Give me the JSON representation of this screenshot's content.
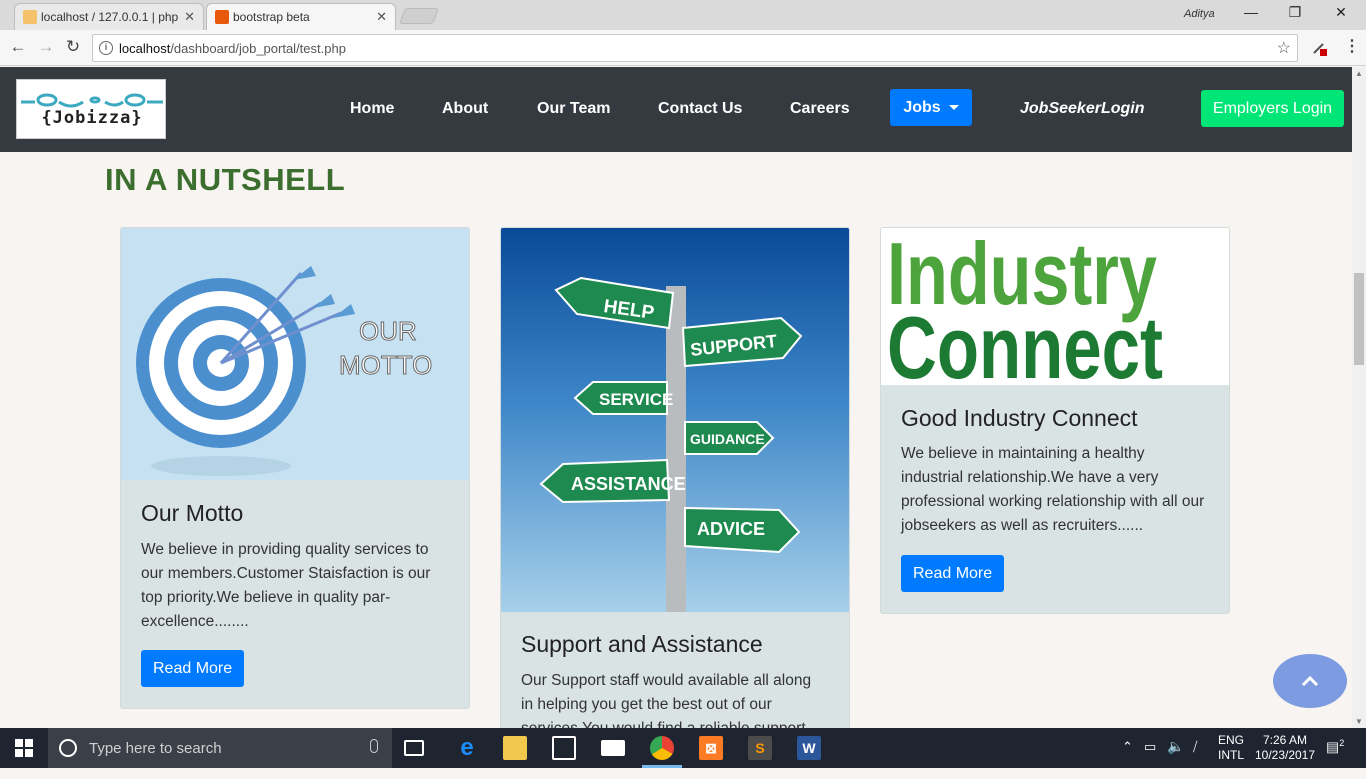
{
  "browser": {
    "tabs": [
      {
        "label": "localhost / 127.0.0.1 | php",
        "favicon_color": "#f29111"
      },
      {
        "label": "bootstrap beta",
        "favicon_color": "#e8590c"
      }
    ],
    "user": "Aditya",
    "window_controls": {
      "minimize": "—",
      "restore": "❐",
      "close": "✕"
    },
    "url_host": "localhost",
    "url_path": "/dashboard/job_portal/test.php"
  },
  "navbar": {
    "logo_text": "{Jobizza}",
    "links": [
      "Home",
      "About",
      "Our Team",
      "Contact Us",
      "Careers"
    ],
    "jobs_label": "Jobs",
    "jobseeker_login": "JobSeekerLogin",
    "employers_login": "Employers Login"
  },
  "section": {
    "title": "IN A NUTSHELL"
  },
  "cards": [
    {
      "title": "Our Motto",
      "image_text": [
        "OUR",
        "MOTTO"
      ],
      "text": "We believe in providing quality services to our members.Customer Staisfaction is our top priority.We believe in quality par-excellence........",
      "button": "Read More"
    },
    {
      "title": "Support and Assistance",
      "image_signs": [
        "HELP",
        "SUPPORT",
        "SERVICE",
        "GUIDANCE",
        "ASSISTANCE",
        "ADVICE"
      ],
      "text": "Our Support staff would available all along in helping you get the best out of our services.You would find a reliable support"
    },
    {
      "title": "Good Industry Connect",
      "image_text": [
        "Industry",
        "Connect"
      ],
      "text": "We believe in maintaining a healthy industrial relationship.We have a very professional working relationship with all our jobseekers as well as recruiters......",
      "button": "Read More"
    }
  ],
  "scroll_top_icon": "chevron-up-icon",
  "taskbar": {
    "search_placeholder": "Type here to search",
    "lang_top": "ENG",
    "lang_bottom": "INTL",
    "time": "7:26 AM",
    "date": "10/23/2017",
    "notification_count": "2"
  },
  "colors": {
    "navbar_bg": "#343a40",
    "primary": "#007bff",
    "success": "#00e676",
    "title_green": "#3c6e2f",
    "card_bg": "#d9e3e3"
  }
}
